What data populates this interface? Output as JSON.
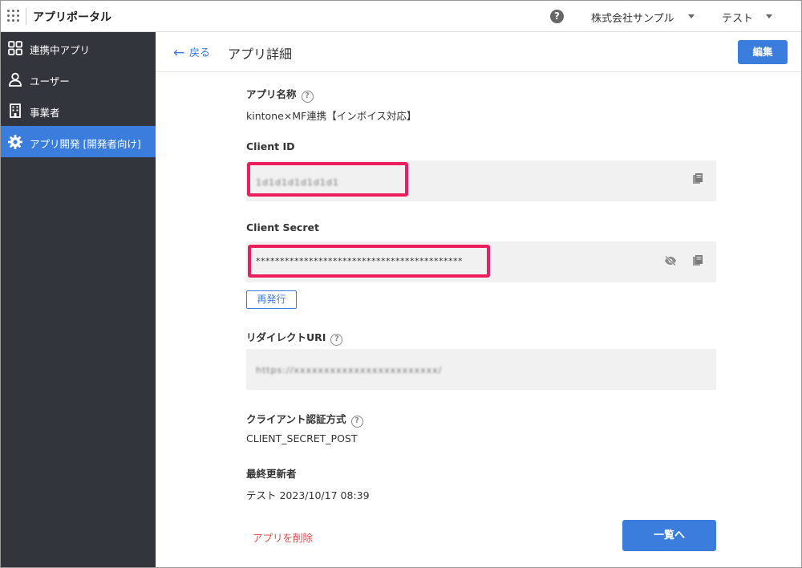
{
  "header": {
    "app_title": "アプリポータル",
    "help_label": "?",
    "company": "株式会社サンプル",
    "user": "テスト"
  },
  "sidebar": {
    "items": [
      {
        "label": "連携中アプリ",
        "icon": "apps-grid-icon"
      },
      {
        "label": "ユーザー",
        "icon": "user-icon"
      },
      {
        "label": "事業者",
        "icon": "building-icon"
      },
      {
        "label": "アプリ開発 [開発者向け]",
        "icon": "gear-icon",
        "active": true
      }
    ]
  },
  "page": {
    "back_label": "戻る",
    "title": "アプリ詳細",
    "edit_label": "編集"
  },
  "fields": {
    "app_name_label": "アプリ名称",
    "app_name_value": "kintone×MF連携【インボイス対応】",
    "client_id_label": "Client ID",
    "client_id_value": "1d1d1d1d1d1d1",
    "client_secret_label": "Client Secret",
    "client_secret_value": "*******************************************",
    "reissue_label": "再発行",
    "redirect_uri_label": "リダイレクトURI",
    "redirect_uri_value": "https://xxxxxxxxxxxxxxxxxxxxxxxx/",
    "auth_method_label": "クライアント認証方式",
    "auth_method_value": "CLIENT_SECRET_POST",
    "updated_by_label": "最終更新者",
    "updated_by_value": "テスト 2023/10/17 08:39"
  },
  "footer": {
    "delete_label": "アプリを削除",
    "list_label": "一覧へ"
  },
  "colors": {
    "accent": "#3b7ddd",
    "sidebar_bg": "#32363c",
    "highlight": "#ee1d5d",
    "danger": "#e14b4b"
  }
}
